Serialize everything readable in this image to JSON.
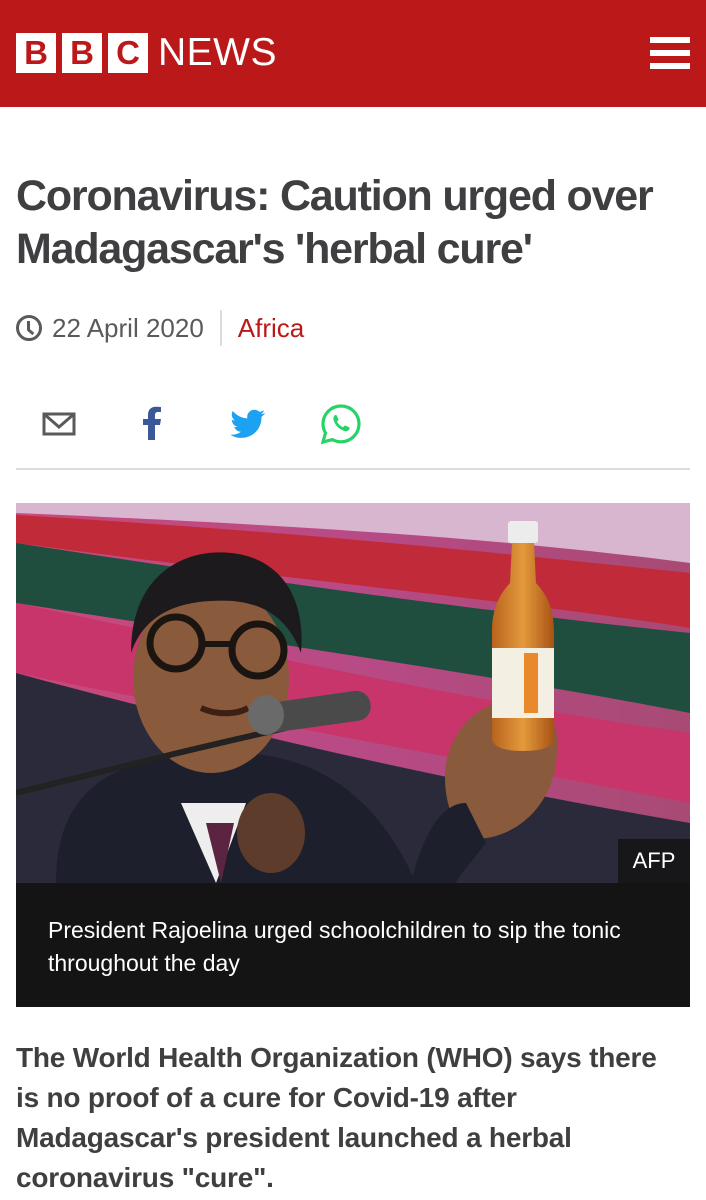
{
  "header": {
    "brand_letters": [
      "B",
      "B",
      "C"
    ],
    "brand_news": "NEWS",
    "menu_icon": "hamburger-menu-icon",
    "bg_color": "#bb1919"
  },
  "article": {
    "headline": "Coronavirus: Caution urged over Madagascar's 'herbal cure'",
    "date": "22 April 2020",
    "section": "Africa",
    "section_color": "#bb1919"
  },
  "share": {
    "icons": [
      "email-icon",
      "facebook-icon",
      "twitter-icon",
      "whatsapp-icon"
    ],
    "colors": {
      "email": "#5a5a5a",
      "facebook": "#3b5998",
      "twitter": "#1da1f2",
      "whatsapp": "#25d366"
    }
  },
  "media": {
    "credit": "AFP",
    "caption": "President Rajoelina urged schoolchildren to sip the tonic throughout the day"
  },
  "lead": {
    "text": "The World Health Organization (WHO) says there is no proof of a cure for Covid-19 after Madagascar's president launched a herbal coronavirus \"cure\"."
  }
}
